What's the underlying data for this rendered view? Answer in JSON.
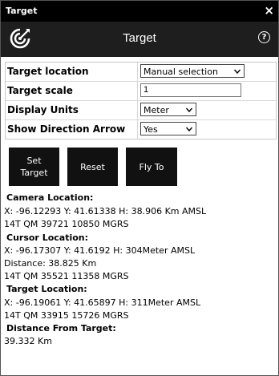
{
  "window": {
    "title": "Target",
    "close_glyph": "×"
  },
  "header": {
    "title": "Target",
    "logo_icon": "target-logo-icon",
    "help_glyph": "?"
  },
  "form": {
    "rows": [
      {
        "label": "Target location",
        "value": "Manual selection"
      },
      {
        "label": "Target scale",
        "value": "1"
      },
      {
        "label": "Display Units",
        "value": "Meter"
      },
      {
        "label": "Show Direction Arrow",
        "value": "Yes"
      }
    ]
  },
  "buttons": {
    "set_target_line1": "Set",
    "set_target_line2": "Target",
    "reset": "Reset",
    "fly_to": "Fly To"
  },
  "camera": {
    "heading": "Camera Location:",
    "coords": "X: -96.12293 Y: 41.61338 H: 38.906 Km AMSL",
    "mgrs": "14T QM 39721 10850 MGRS"
  },
  "cursor": {
    "heading": "Cursor Location:",
    "coords": "X: -96.17307 Y: 41.6192 H: 304Meter AMSL",
    "distance": "Distance: 38.825 Km",
    "mgrs": "14T QM 35521 11358 MGRS"
  },
  "target": {
    "heading": "Target Location:",
    "coords": "X: -96.19061 Y: 41.65897 H: 311Meter AMSL",
    "mgrs": "14T QM 33915 15726 MGRS"
  },
  "distance_from_target": {
    "heading": "Distance From Target:",
    "value": "39.332 Km"
  },
  "colors": {
    "header_bg": "#1e1e1e",
    "titlebar_bg": "#000000",
    "button_bg": "#111111"
  }
}
